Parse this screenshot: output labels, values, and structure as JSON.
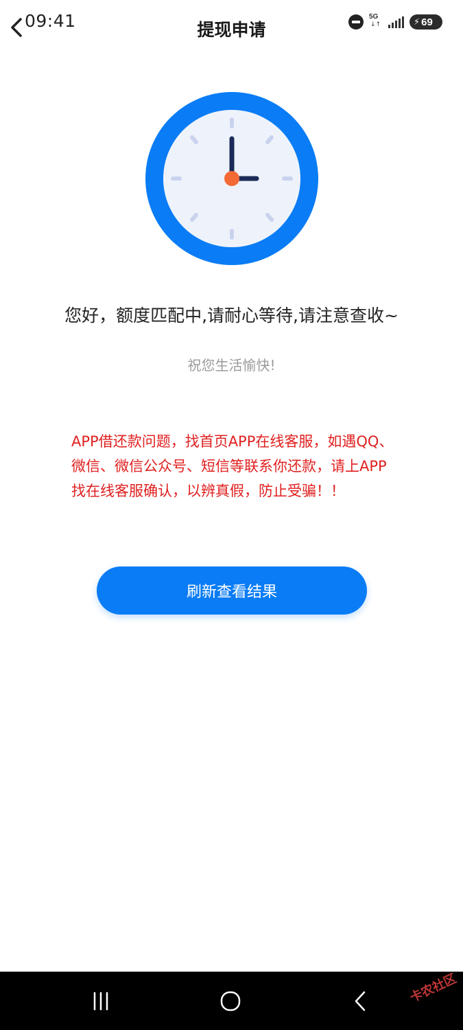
{
  "status_bar": {
    "time": "09:41",
    "network": "5G",
    "battery": "69"
  },
  "header": {
    "title": "提现申请"
  },
  "main": {
    "message": "您好，额度匹配中,请耐心等待,请注意查收~",
    "wish": "祝您生活愉快!",
    "warning": "APP借还款问题，找首页APP在线客服，如遇QQ、微信、微信公众号、短信等联系你还款，请上APP找在线客服确认，以辨真假，防止受骗！！",
    "refresh_button": "刷新查看结果"
  },
  "clock_icon": {
    "ring_color": "#0a7cf5",
    "face_color": "#eef3fb",
    "hand_color": "#1b2a57",
    "center_color": "#f46a35",
    "time_shown": "3:00"
  },
  "nav_bar": {
    "icons": [
      "recent-apps-icon",
      "home-icon",
      "back-icon"
    ]
  },
  "watermark": {
    "text": "卡农社区"
  },
  "colors": {
    "accent": "#0a7cf5",
    "warning": "#e02020",
    "muted": "#9a9a9a"
  }
}
